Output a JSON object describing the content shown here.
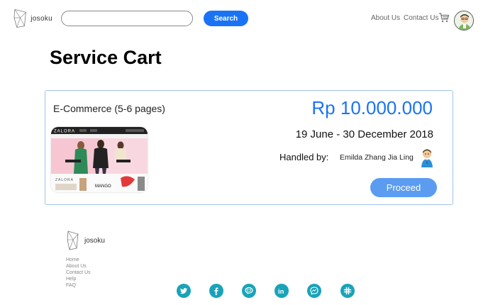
{
  "header": {
    "logo_text": "josoku",
    "search_placeholder": "",
    "search_button": "Search",
    "nav": {
      "about": "About Us",
      "contact": "Contact Us"
    }
  },
  "page": {
    "title": "Service Cart"
  },
  "cart_item": {
    "service": "E-Commerce (5-6 pages)",
    "price": "Rp 10.000.000",
    "dates": "19 June - 30 December 2018",
    "handled_label": "Handled by:",
    "handler": "Emilda Zhang Jia Ling",
    "proceed_button": "Proceed",
    "thumbnail": {
      "brand": "ZALORA",
      "banner_brand": "ZALORA",
      "partner": "MANGO"
    }
  },
  "footer": {
    "logo_text": "josoku",
    "links": [
      "Home",
      "About Us",
      "Contact Us",
      "Help",
      "FAQ"
    ],
    "social": [
      "twitter-icon",
      "facebook-icon",
      "line-icon",
      "linkedin-icon",
      "messenger-icon",
      "slack-icon"
    ],
    "social_color": "#1aa3b8"
  },
  "colors": {
    "accent": "#1a73f5",
    "proceed": "#5b9cf0",
    "card_border": "#9fc4f0"
  }
}
